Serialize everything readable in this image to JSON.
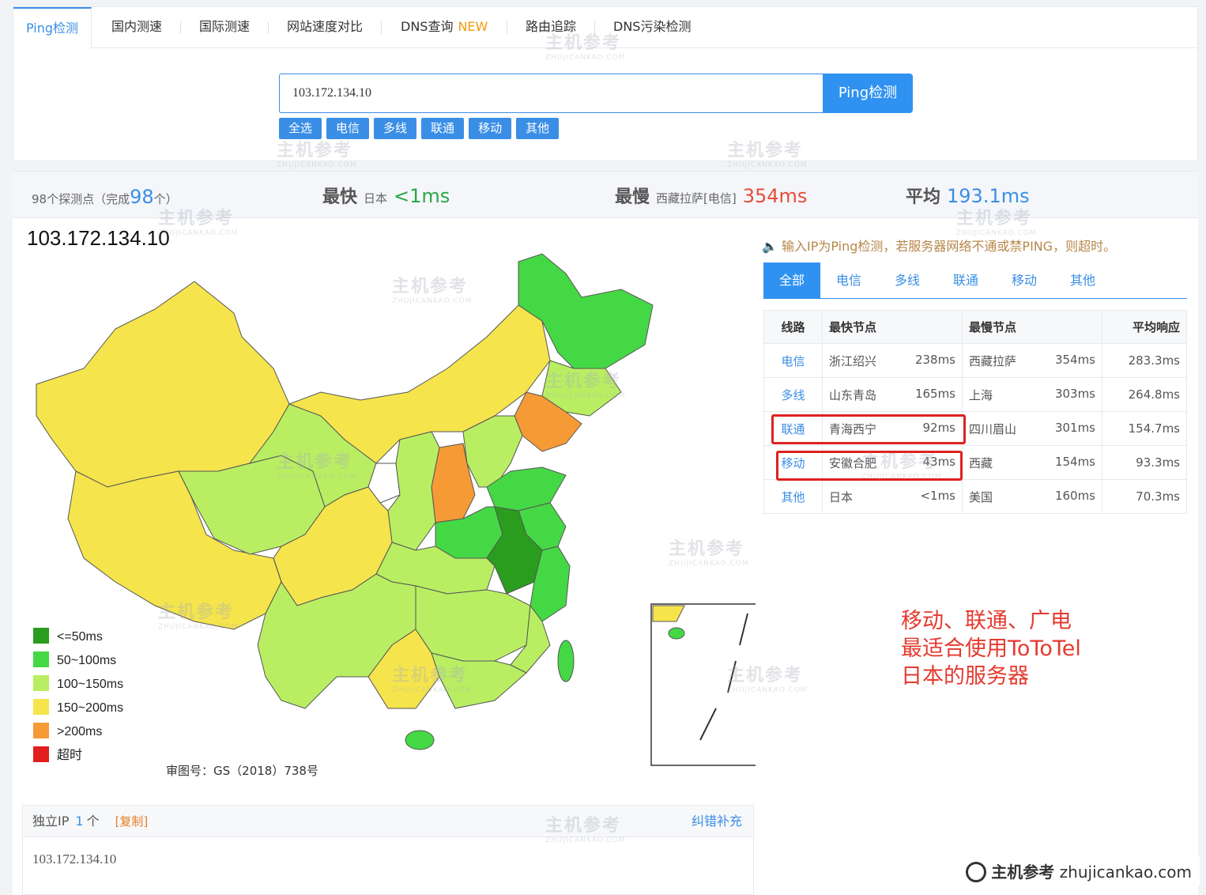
{
  "tabs": [
    {
      "label": "Ping检测",
      "badge": ""
    },
    {
      "label": "国内测速",
      "badge": ""
    },
    {
      "label": "国际测速",
      "badge": ""
    },
    {
      "label": "网站速度对比",
      "badge": ""
    },
    {
      "label": "DNS查询",
      "badge": "NEW"
    },
    {
      "label": "路由追踪",
      "badge": ""
    },
    {
      "label": "DNS污染检测",
      "badge": ""
    }
  ],
  "search": {
    "value": "103.172.134.10",
    "button": "Ping检测"
  },
  "filters": [
    "全选",
    "电信",
    "多线",
    "联通",
    "移动",
    "其他"
  ],
  "stats": {
    "nodes_prefix": "98个探测点（完成",
    "nodes_done": "98",
    "nodes_suffix": "个）",
    "fastest_label": "最快",
    "fastest_loc": "日本",
    "fastest_val": "<1ms",
    "slowest_label": "最慢",
    "slowest_loc": "西藏拉萨[电信]",
    "slowest_val": "354ms",
    "avg_label": "平均",
    "avg_val": "193.1ms"
  },
  "map": {
    "title": "103.172.134.10",
    "approval": "审图号：GS（2018）738号",
    "legend": [
      {
        "label": "<=50ms",
        "color": "#2a9d1f"
      },
      {
        "label": "50~100ms",
        "color": "#45d845"
      },
      {
        "label": "100~150ms",
        "color": "#b9ee62"
      },
      {
        "label": "150~200ms",
        "color": "#f5e44c"
      },
      {
        "label": ">200ms",
        "color": "#f59a35"
      },
      {
        "label": "超时",
        "color": "#e21f1f"
      }
    ]
  },
  "notice": "输入IP为Ping检测，若服务器网络不通或禁PING，则超时。",
  "result_tabs": [
    "全部",
    "电信",
    "多线",
    "联通",
    "移动",
    "其他"
  ],
  "table": {
    "headers": {
      "line": "线路",
      "fastest": "最快节点",
      "slowest": "最慢节点",
      "avg": "平均响应"
    },
    "rows": [
      {
        "line": "电信",
        "fast_node": "浙江绍兴",
        "fast_ms": "238ms",
        "slow_node": "西藏拉萨",
        "slow_ms": "354ms",
        "avg": "283.3ms"
      },
      {
        "line": "多线",
        "fast_node": "山东青岛",
        "fast_ms": "165ms",
        "slow_node": "上海",
        "slow_ms": "303ms",
        "avg": "264.8ms"
      },
      {
        "line": "联通",
        "fast_node": "青海西宁",
        "fast_ms": "92ms",
        "slow_node": "四川眉山",
        "slow_ms": "301ms",
        "avg": "154.7ms"
      },
      {
        "line": "移动",
        "fast_node": "安徽合肥",
        "fast_ms": "43ms",
        "slow_node": "西藏",
        "slow_ms": "154ms",
        "avg": "93.3ms"
      },
      {
        "line": "其他",
        "fast_node": "日本",
        "fast_ms": "<1ms",
        "slow_node": "美国",
        "slow_ms": "160ms",
        "avg": "70.3ms"
      }
    ]
  },
  "annotation": [
    "移动、联通、广电",
    "最适合使用ToToTel",
    "日本的服务器"
  ],
  "ip_panel": {
    "label": "独立IP",
    "count": "1",
    "unit": "个",
    "copy": "[复制]",
    "fix": "纠错补充",
    "ips": [
      "103.172.134.10"
    ]
  },
  "watermark": {
    "text": "主机参考",
    "sub": "ZHUJICANKAO.COM"
  },
  "brand": {
    "name": "主机参考",
    "domain": "zhujicankao.com"
  }
}
